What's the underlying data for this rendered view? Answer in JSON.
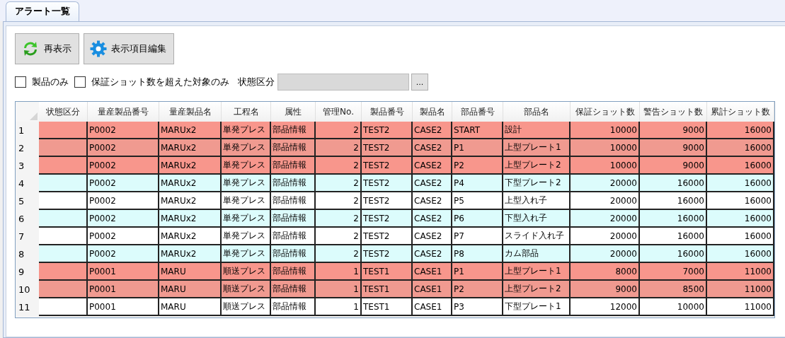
{
  "tabs": [
    {
      "label": "アラート一覧",
      "selected": true
    }
  ],
  "buttons": [
    {
      "kind": "refresh",
      "label": "再表示"
    },
    {
      "kind": "settings",
      "label": "表示項目編集"
    }
  ],
  "filters": [
    {
      "label": "製品のみ",
      "checked": false
    },
    {
      "label": "保証ショット数を超えた対象のみ",
      "checked": false
    }
  ],
  "status_filter": {
    "label": "状態区分",
    "disabled": true,
    "button": "..."
  },
  "table": {
    "columns": [
      {
        "label": "状態区分",
        "kind": "status"
      },
      {
        "label": "量産製品番号",
        "kind": "text"
      },
      {
        "label": "量産製品名",
        "kind": "text"
      },
      {
        "label": "工程名",
        "kind": "text"
      },
      {
        "label": "属性",
        "kind": "text"
      },
      {
        "label": "管理No.",
        "kind": "number"
      },
      {
        "label": "製品番号",
        "kind": "text"
      },
      {
        "label": "製品名",
        "kind": "text"
      },
      {
        "label": "部品番号",
        "kind": "text"
      },
      {
        "label": "部品名",
        "kind": "text"
      },
      {
        "label": "保証ショット数",
        "kind": "number"
      },
      {
        "label": "警告ショット数",
        "kind": "number"
      },
      {
        "label": "累計ショット数",
        "kind": "number"
      }
    ],
    "rows": [
      {
        "number": "1",
        "color": "#f8968c",
        "cells": [
          "",
          "P0002",
          "MARUx2",
          "単発プレス",
          "部品情報",
          "2",
          "TEST2",
          "CASE2",
          "START",
          "設計",
          "10000",
          "9000",
          "16000"
        ]
      },
      {
        "number": "2",
        "color": "#f09a90",
        "cells": [
          "",
          "P0002",
          "MARUx2",
          "単発プレス",
          "部品情報",
          "2",
          "TEST2",
          "CASE2",
          "P1",
          "上型プレート1",
          "10000",
          "9000",
          "16000"
        ]
      },
      {
        "number": "3",
        "color": "#f8968c",
        "cells": [
          "",
          "P0002",
          "MARUx2",
          "単発プレス",
          "部品情報",
          "2",
          "TEST2",
          "CASE2",
          "P2",
          "上型プレート2",
          "10000",
          "9000",
          "16000"
        ]
      },
      {
        "number": "4",
        "color": "#dcfcfc",
        "cells": [
          "",
          "P0002",
          "MARUx2",
          "単発プレス",
          "部品情報",
          "2",
          "TEST2",
          "CASE2",
          "P4",
          "下型プレート2",
          "20000",
          "16000",
          "16000"
        ]
      },
      {
        "number": "5",
        "color": "#ffffff",
        "cells": [
          "",
          "P0002",
          "MARUx2",
          "単発プレス",
          "部品情報",
          "2",
          "TEST2",
          "CASE2",
          "P5",
          "上型入れ子",
          "20000",
          "16000",
          "16000"
        ]
      },
      {
        "number": "6",
        "color": "#dcfcfc",
        "cells": [
          "",
          "P0002",
          "MARUx2",
          "単発プレス",
          "部品情報",
          "2",
          "TEST2",
          "CASE2",
          "P6",
          "下型入れ子",
          "20000",
          "16000",
          "16000"
        ]
      },
      {
        "number": "7",
        "color": "#ffffff",
        "cells": [
          "",
          "P0002",
          "MARUx2",
          "単発プレス",
          "部品情報",
          "2",
          "TEST2",
          "CASE2",
          "P7",
          "スライド入れ子",
          "20000",
          "16000",
          "16000"
        ]
      },
      {
        "number": "8",
        "color": "#dcfcfc",
        "cells": [
          "",
          "P0002",
          "MARUx2",
          "単発プレス",
          "部品情報",
          "2",
          "TEST2",
          "CASE2",
          "P8",
          "カム部品",
          "20000",
          "16000",
          "16000"
        ]
      },
      {
        "number": "9",
        "color": "#f8968c",
        "cells": [
          "",
          "P0001",
          "MARU",
          "順送プレス",
          "部品情報",
          "1",
          "TEST1",
          "CASE1",
          "P1",
          "上型プレート1",
          "8000",
          "7000",
          "11000"
        ]
      },
      {
        "number": "10",
        "color": "#f09a90",
        "cells": [
          "",
          "P0001",
          "MARU",
          "順送プレス",
          "部品情報",
          "1",
          "TEST1",
          "CASE1",
          "P2",
          "上型プレート2",
          "9000",
          "8500",
          "11000"
        ]
      },
      {
        "number": "11",
        "color": "#ffffff",
        "cells": [
          "",
          "P0001",
          "MARU",
          "順送プレス",
          "部品情報",
          "1",
          "TEST1",
          "CASE1",
          "P3",
          "下型プレート1",
          "12000",
          "10000",
          "11000"
        ]
      }
    ]
  }
}
